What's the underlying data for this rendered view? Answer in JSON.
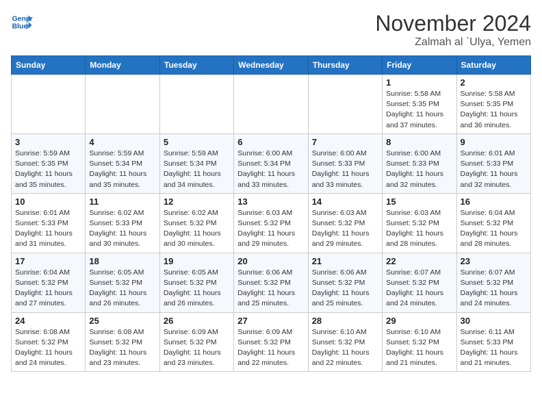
{
  "header": {
    "logo_line1": "General",
    "logo_line2": "Blue",
    "month": "November 2024",
    "location": "Zalmah al `Ulya, Yemen"
  },
  "weekdays": [
    "Sunday",
    "Monday",
    "Tuesday",
    "Wednesday",
    "Thursday",
    "Friday",
    "Saturday"
  ],
  "weeks": [
    [
      {
        "day": "",
        "detail": ""
      },
      {
        "day": "",
        "detail": ""
      },
      {
        "day": "",
        "detail": ""
      },
      {
        "day": "",
        "detail": ""
      },
      {
        "day": "",
        "detail": ""
      },
      {
        "day": "1",
        "detail": "Sunrise: 5:58 AM\nSunset: 5:35 PM\nDaylight: 11 hours and 37 minutes."
      },
      {
        "day": "2",
        "detail": "Sunrise: 5:58 AM\nSunset: 5:35 PM\nDaylight: 11 hours and 36 minutes."
      }
    ],
    [
      {
        "day": "3",
        "detail": "Sunrise: 5:59 AM\nSunset: 5:35 PM\nDaylight: 11 hours and 35 minutes."
      },
      {
        "day": "4",
        "detail": "Sunrise: 5:59 AM\nSunset: 5:34 PM\nDaylight: 11 hours and 35 minutes."
      },
      {
        "day": "5",
        "detail": "Sunrise: 5:59 AM\nSunset: 5:34 PM\nDaylight: 11 hours and 34 minutes."
      },
      {
        "day": "6",
        "detail": "Sunrise: 6:00 AM\nSunset: 5:34 PM\nDaylight: 11 hours and 33 minutes."
      },
      {
        "day": "7",
        "detail": "Sunrise: 6:00 AM\nSunset: 5:33 PM\nDaylight: 11 hours and 33 minutes."
      },
      {
        "day": "8",
        "detail": "Sunrise: 6:00 AM\nSunset: 5:33 PM\nDaylight: 11 hours and 32 minutes."
      },
      {
        "day": "9",
        "detail": "Sunrise: 6:01 AM\nSunset: 5:33 PM\nDaylight: 11 hours and 32 minutes."
      }
    ],
    [
      {
        "day": "10",
        "detail": "Sunrise: 6:01 AM\nSunset: 5:33 PM\nDaylight: 11 hours and 31 minutes."
      },
      {
        "day": "11",
        "detail": "Sunrise: 6:02 AM\nSunset: 5:33 PM\nDaylight: 11 hours and 30 minutes."
      },
      {
        "day": "12",
        "detail": "Sunrise: 6:02 AM\nSunset: 5:32 PM\nDaylight: 11 hours and 30 minutes."
      },
      {
        "day": "13",
        "detail": "Sunrise: 6:03 AM\nSunset: 5:32 PM\nDaylight: 11 hours and 29 minutes."
      },
      {
        "day": "14",
        "detail": "Sunrise: 6:03 AM\nSunset: 5:32 PM\nDaylight: 11 hours and 29 minutes."
      },
      {
        "day": "15",
        "detail": "Sunrise: 6:03 AM\nSunset: 5:32 PM\nDaylight: 11 hours and 28 minutes."
      },
      {
        "day": "16",
        "detail": "Sunrise: 6:04 AM\nSunset: 5:32 PM\nDaylight: 11 hours and 28 minutes."
      }
    ],
    [
      {
        "day": "17",
        "detail": "Sunrise: 6:04 AM\nSunset: 5:32 PM\nDaylight: 11 hours and 27 minutes."
      },
      {
        "day": "18",
        "detail": "Sunrise: 6:05 AM\nSunset: 5:32 PM\nDaylight: 11 hours and 26 minutes."
      },
      {
        "day": "19",
        "detail": "Sunrise: 6:05 AM\nSunset: 5:32 PM\nDaylight: 11 hours and 26 minutes."
      },
      {
        "day": "20",
        "detail": "Sunrise: 6:06 AM\nSunset: 5:32 PM\nDaylight: 11 hours and 25 minutes."
      },
      {
        "day": "21",
        "detail": "Sunrise: 6:06 AM\nSunset: 5:32 PM\nDaylight: 11 hours and 25 minutes."
      },
      {
        "day": "22",
        "detail": "Sunrise: 6:07 AM\nSunset: 5:32 PM\nDaylight: 11 hours and 24 minutes."
      },
      {
        "day": "23",
        "detail": "Sunrise: 6:07 AM\nSunset: 5:32 PM\nDaylight: 11 hours and 24 minutes."
      }
    ],
    [
      {
        "day": "24",
        "detail": "Sunrise: 6:08 AM\nSunset: 5:32 PM\nDaylight: 11 hours and 24 minutes."
      },
      {
        "day": "25",
        "detail": "Sunrise: 6:08 AM\nSunset: 5:32 PM\nDaylight: 11 hours and 23 minutes."
      },
      {
        "day": "26",
        "detail": "Sunrise: 6:09 AM\nSunset: 5:32 PM\nDaylight: 11 hours and 23 minutes."
      },
      {
        "day": "27",
        "detail": "Sunrise: 6:09 AM\nSunset: 5:32 PM\nDaylight: 11 hours and 22 minutes."
      },
      {
        "day": "28",
        "detail": "Sunrise: 6:10 AM\nSunset: 5:32 PM\nDaylight: 11 hours and 22 minutes."
      },
      {
        "day": "29",
        "detail": "Sunrise: 6:10 AM\nSunset: 5:32 PM\nDaylight: 11 hours and 21 minutes."
      },
      {
        "day": "30",
        "detail": "Sunrise: 6:11 AM\nSunset: 5:33 PM\nDaylight: 11 hours and 21 minutes."
      }
    ]
  ]
}
